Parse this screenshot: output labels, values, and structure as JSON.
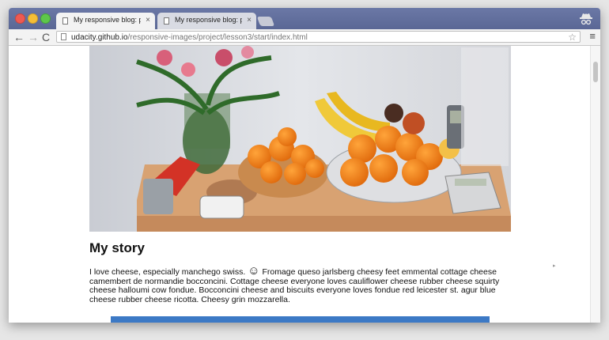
{
  "browser": {
    "tabs": [
      {
        "title": "My responsive blog: pictur",
        "close": "×",
        "active": true
      },
      {
        "title": "My responsive blog: pictur",
        "close": "×",
        "active": false
      }
    ],
    "address": {
      "host": "udacity.github.io",
      "path": "/responsive-images/project/lesson3/start/index.html"
    },
    "nav": {
      "back": "←",
      "forward": "→",
      "reload": "C"
    },
    "icons": {
      "star": "☆",
      "menu": "≡"
    }
  },
  "page": {
    "hero_image_alt": "fruit and flowers",
    "heading": "My story",
    "paragraph_before": "I love cheese, especially manchego swiss.",
    "smiley": "☺",
    "paragraph_after": "Fromage queso jarlsberg cheesy feet emmental cottage cheese camembert de normandie bocconcini. Cottage cheese everyone loves cauliflower cheese rubber cheese squirty cheese halloumi cow fondue. Bocconcini cheese and biscuits everyone loves fondue red leicester st. agur blue cheese rubber cheese ricotta. Cheesy grin mozzarella."
  },
  "colors": {
    "accent_block": "#3c79c5",
    "titlebar": "#5a6795"
  }
}
